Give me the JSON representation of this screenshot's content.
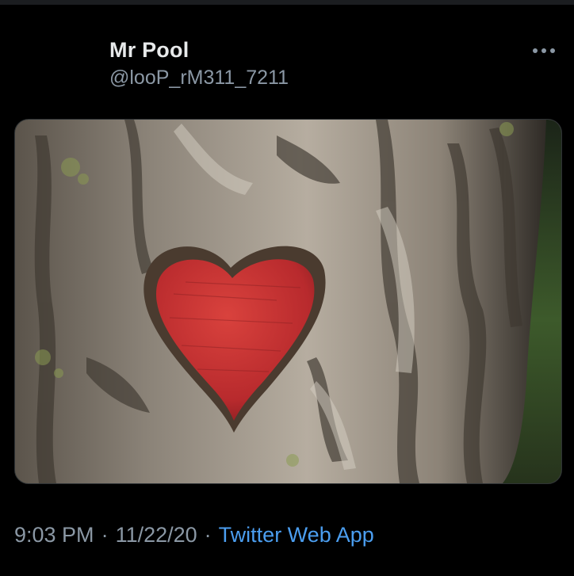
{
  "tweet": {
    "author_name": "Mr Pool",
    "author_handle": "@looP_rM311_7211",
    "time": "9:03 PM",
    "date": "11/22/20",
    "source": "Twitter Web App",
    "separator": "·"
  },
  "media": {
    "image_description_icon": "photo",
    "colors": {
      "bark": "#6f665c",
      "heart": "#c22d2f",
      "foliage": "#334b27"
    }
  },
  "icons": {
    "more": "more-horizontal-icon"
  }
}
